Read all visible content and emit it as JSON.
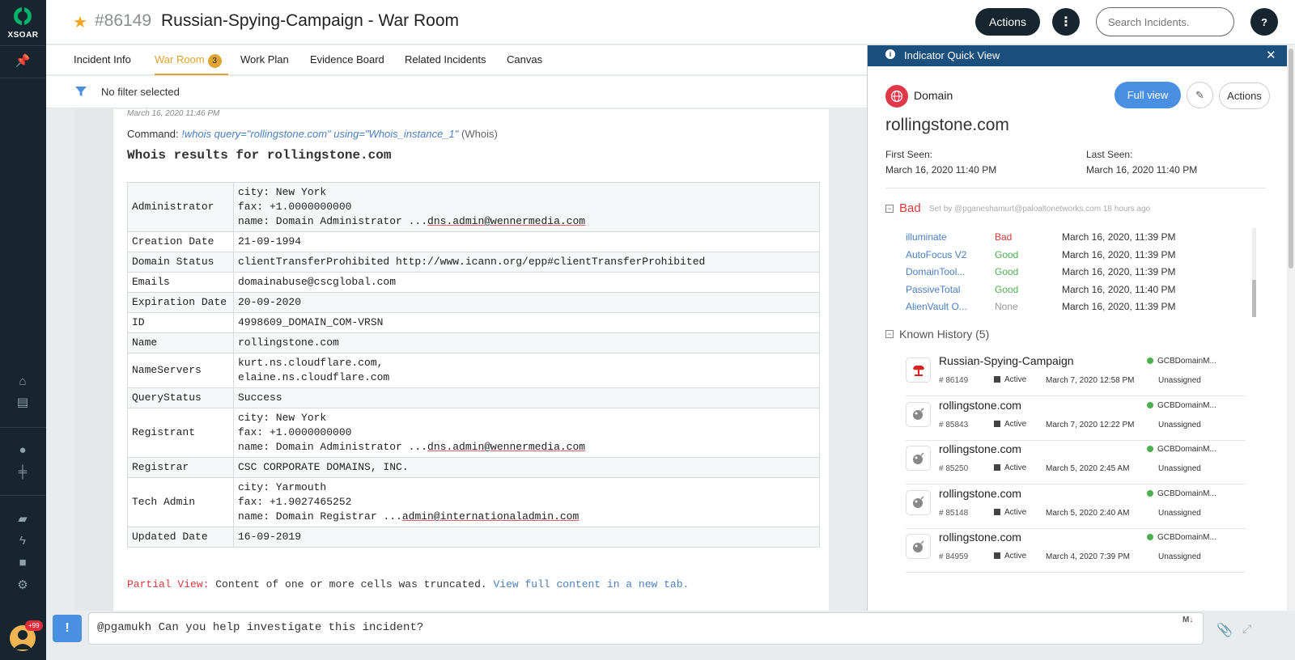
{
  "app": {
    "logo_text": "XSOAR"
  },
  "sidebar": {
    "icons": [
      "pin-icon",
      "home-icon",
      "dashboard-icon",
      "bomb-icon",
      "indicator-icon",
      "playbook-icon",
      "automation-icon",
      "briefcase-icon",
      "gear-icon"
    ],
    "user_badge": "+99"
  },
  "header": {
    "incident_id": "#86149",
    "incident_title": "Russian-Spying-Campaign - War Room",
    "actions_label": "Actions",
    "search_placeholder": "Search Incidents.",
    "help_label": "?"
  },
  "tabs": [
    {
      "label": "Incident Info"
    },
    {
      "label": "War Room",
      "badge": "3",
      "active": true
    },
    {
      "label": "Work Plan"
    },
    {
      "label": "Evidence Board"
    },
    {
      "label": "Related Incidents"
    },
    {
      "label": "Canvas"
    }
  ],
  "filter": {
    "text": "No filter selected"
  },
  "entry": {
    "timestamp": "March 16, 2020 11:46 PM",
    "command_label": "Command:",
    "command": "!whois query=\"rollingstone.com\" using=\"Whois_instance_1\"",
    "command_source": "(Whois)",
    "title": "Whois results for rollingstone.com",
    "rows": [
      {
        "key": "Administrator",
        "lines": [
          "city: New York",
          "fax: +1.0000000000",
          "name: Domain Administrator ..."
        ],
        "email": "dns.admin@wennermedia.com"
      },
      {
        "key": "Creation Date",
        "lines": [
          "21-09-1994"
        ]
      },
      {
        "key": "Domain Status",
        "lines": [
          "clientTransferProhibited http://www.icann.org/epp#clientTransferProhibited"
        ]
      },
      {
        "key": "Emails",
        "lines": [
          "domainabuse@cscglobal.com"
        ]
      },
      {
        "key": "Expiration Date",
        "lines": [
          "20-09-2020"
        ]
      },
      {
        "key": "ID",
        "lines": [
          "4998609_DOMAIN_COM-VRSN"
        ]
      },
      {
        "key": "Name",
        "lines": [
          "rollingstone.com"
        ]
      },
      {
        "key": "NameServers",
        "lines": [
          "kurt.ns.cloudflare.com,",
          "elaine.ns.cloudflare.com"
        ]
      },
      {
        "key": "QueryStatus",
        "lines": [
          "Success"
        ]
      },
      {
        "key": "Registrant",
        "lines": [
          "city: New York",
          "fax: +1.0000000000",
          "name: Domain Administrator ..."
        ],
        "email": "dns.admin@wennermedia.com"
      },
      {
        "key": "Registrar",
        "lines": [
          "CSC CORPORATE DOMAINS, INC."
        ]
      },
      {
        "key": "Tech Admin",
        "lines": [
          "city: Yarmouth",
          "fax: +1.9027465252",
          "name: Domain Registrar ..."
        ],
        "email": "admin@internationaladmin.com"
      },
      {
        "key": "Updated Date",
        "lines": [
          "16-09-2019"
        ]
      }
    ],
    "partial_label": "Partial View:",
    "partial_text": " Content of one or more cells was truncated. ",
    "partial_link": "View full content in a new tab."
  },
  "chat": {
    "bang_label": "!",
    "input_value": "@pgamukh Can you help investigate this incident?",
    "markdown_label": "M↓"
  },
  "indicator_panel": {
    "title": "Indicator Quick View",
    "type": "Domain",
    "full_view_label": "Full view",
    "actions_label": "Actions",
    "value": "rollingstone.com",
    "first_seen_label": "First Seen:",
    "first_seen": "March 16, 2020 11:40 PM",
    "last_seen_label": "Last Seen:",
    "last_seen": "March 16, 2020 11:40 PM",
    "verdict": "Bad",
    "verdict_meta": "Set by @pganeshamurt@paloaltonetworks.com 18 hours ago",
    "reputations": [
      {
        "source": "illuminate",
        "verdict": "Bad",
        "date": "March 16, 2020, 11:39 PM",
        "color": "#d93a3a"
      },
      {
        "source": "AutoFocus V2",
        "verdict": "Good",
        "date": "March 16, 2020, 11:39 PM",
        "color": "#4caf50"
      },
      {
        "source": "DomainTool...",
        "verdict": "Good",
        "date": "March 16, 2020, 11:39 PM",
        "color": "#4caf50"
      },
      {
        "source": "PassiveTotal",
        "verdict": "Good",
        "date": "March 16, 2020, 11:40 PM",
        "color": "#4caf50"
      },
      {
        "source": "AlienVault O...",
        "verdict": "None",
        "date": "March 16, 2020, 11:39 PM",
        "color": "#999999"
      }
    ],
    "known_history_title": "Known History (5)",
    "history": [
      {
        "name": "Russian-Spying-Campaign",
        "number": "# 86149",
        "status": "Active",
        "date": "March 7, 2020 12:58 PM",
        "owner": "GCBDomainM...",
        "assignee": "Unassigned",
        "icon": "explosion-icon"
      },
      {
        "name": "rollingstone.com",
        "number": "# 85843",
        "status": "Active",
        "date": "March 7, 2020 12:22 PM",
        "owner": "GCBDomainM...",
        "assignee": "Unassigned",
        "icon": "bomb-icon"
      },
      {
        "name": "rollingstone.com",
        "number": "# 85250",
        "status": "Active",
        "date": "March 5, 2020 2:45 AM",
        "owner": "GCBDomainM...",
        "assignee": "Unassigned",
        "icon": "bomb-icon"
      },
      {
        "name": "rollingstone.com",
        "number": "# 85148",
        "status": "Active",
        "date": "March 5, 2020 2:40 AM",
        "owner": "GCBDomainM...",
        "assignee": "Unassigned",
        "icon": "bomb-icon"
      },
      {
        "name": "rollingstone.com",
        "number": "# 84959",
        "status": "Active",
        "date": "March 4, 2020 7:39 PM",
        "owner": "GCBDomainM...",
        "assignee": "Unassigned",
        "icon": "bomb-icon"
      }
    ]
  }
}
